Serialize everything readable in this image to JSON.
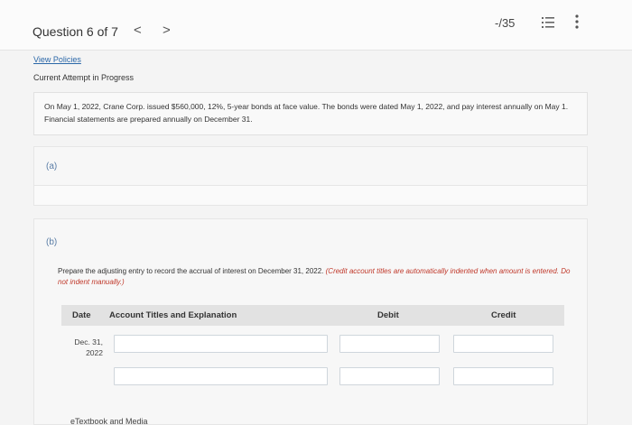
{
  "header": {
    "question_title": "Question 6 of 7",
    "prev_glyph": "<",
    "next_glyph": ">",
    "score": "-/35"
  },
  "links": {
    "view_policies": "View Policies"
  },
  "status": {
    "attempt": "Current Attempt in Progress"
  },
  "problem": {
    "text": "On May 1, 2022, Crane Corp. issued $560,000, 12%, 5-year bonds at face value. The bonds were dated May 1, 2022, and pay interest annually on May 1. Financial statements are prepared annually on December 31."
  },
  "part_a": {
    "label": "(a)"
  },
  "part_b": {
    "label": "(b)",
    "instruction_main": "Prepare the adjusting entry to record the accrual of interest on December 31, 2022. ",
    "instruction_note": "(Credit account titles are automatically indented when amount is entered. Do not indent manually.)",
    "table": {
      "headers": {
        "date": "Date",
        "account": "Account Titles and Explanation",
        "debit": "Debit",
        "credit": "Credit"
      },
      "rows": [
        {
          "date_line1": "Dec. 31,",
          "date_line2": "2022",
          "account": "",
          "debit": "",
          "credit": ""
        },
        {
          "date_line1": "",
          "date_line2": "",
          "account": "",
          "debit": "",
          "credit": ""
        }
      ]
    },
    "etextbook": "eTextbook and Media"
  },
  "icons": {
    "list": "list-icon",
    "more": "more-vertical-icon"
  },
  "colors": {
    "link": "#2a67a8",
    "emphasis": "#c0392b",
    "part_label": "#5a7da6"
  }
}
